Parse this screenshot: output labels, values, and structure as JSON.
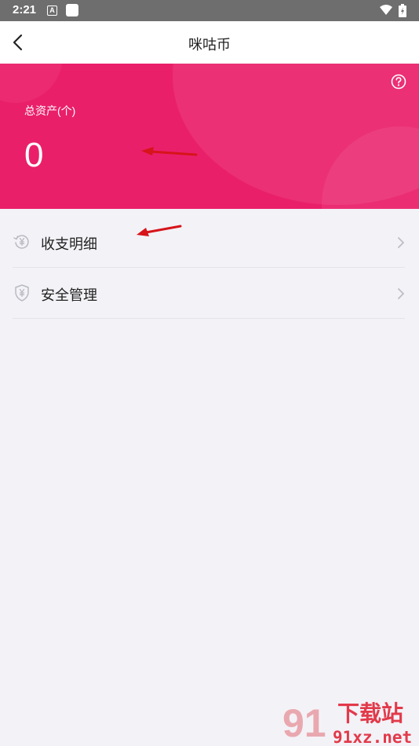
{
  "status_bar": {
    "time": "2:21",
    "notif_letter": "A"
  },
  "title_bar": {
    "title": "咪咕币"
  },
  "banner": {
    "asset_label": "总资产(个)",
    "asset_value": "0",
    "color": "#ea1f6a"
  },
  "menu": {
    "items": [
      {
        "label": "收支明细",
        "icon": "yuan-history-icon"
      },
      {
        "label": "安全管理",
        "icon": "yuan-shield-icon"
      }
    ]
  },
  "watermark": {
    "text_main": "下载站",
    "text_sub": "91xz.net",
    "digits": "91"
  }
}
